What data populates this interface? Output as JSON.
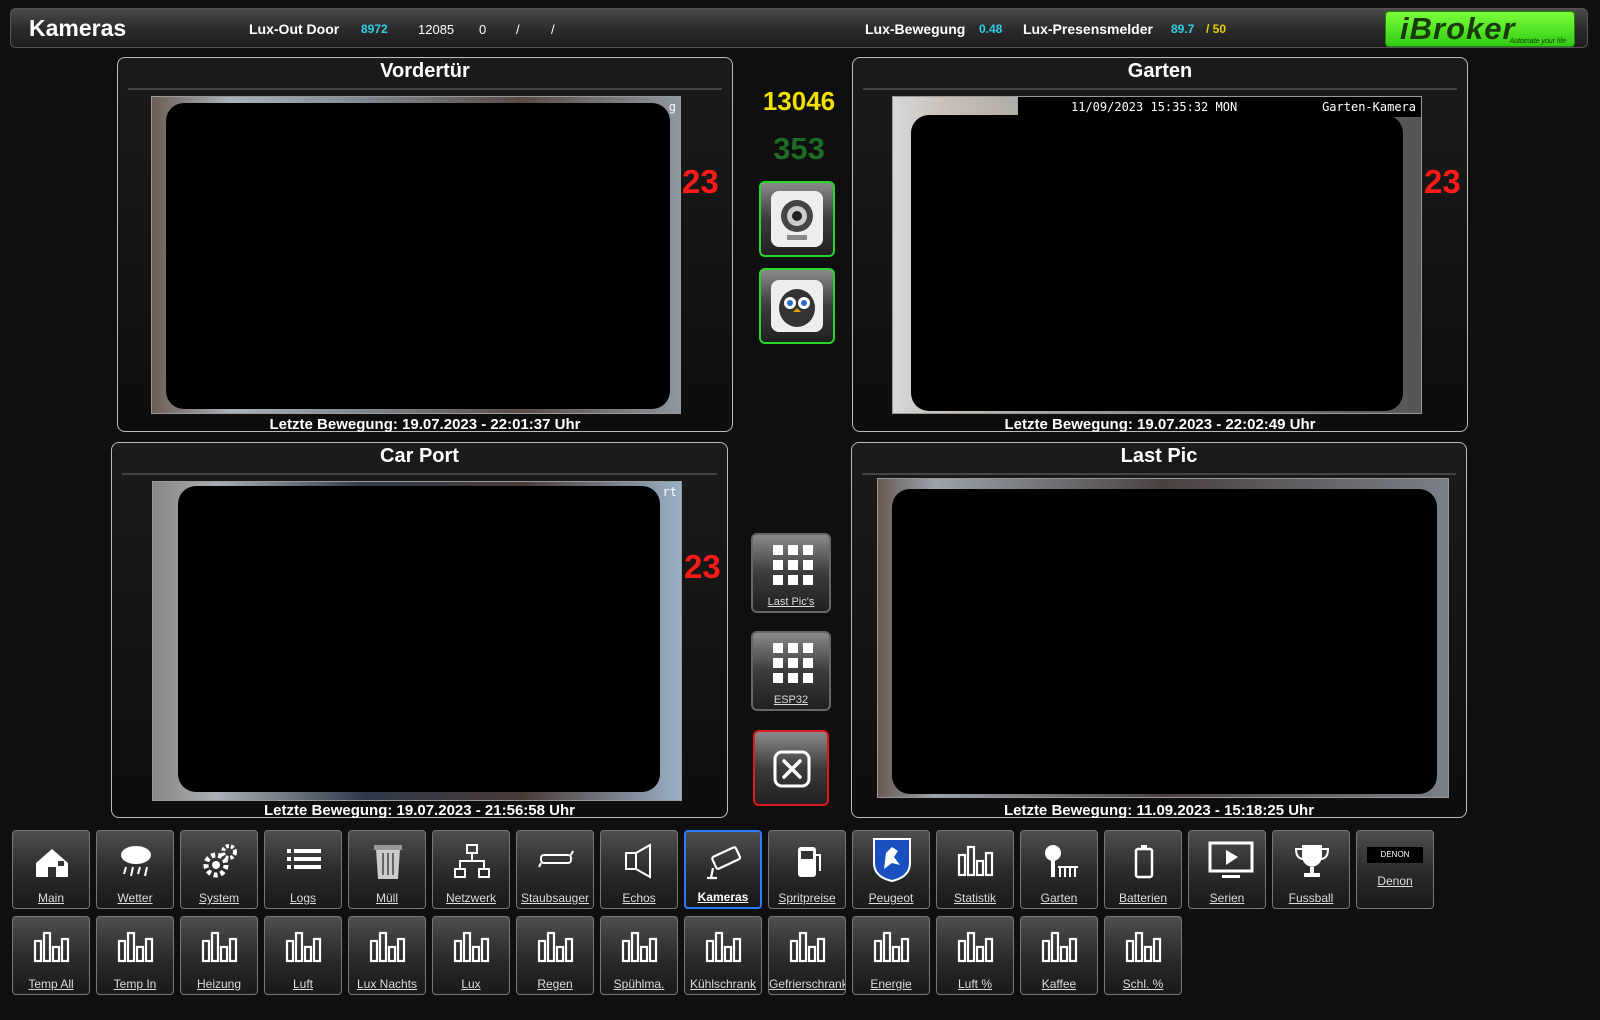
{
  "header": {
    "title": "Kameras",
    "lux_out_door_label": "Lux-Out Door",
    "lux_out_door_value": "8972",
    "value_b": "12085",
    "value_c": "0",
    "sep1": "/",
    "sep2": "/",
    "lux_bewegung_label": "Lux-Bewegung",
    "lux_bewegung_value": "0.48",
    "lux_presens_label": "Lux-Presensmelder",
    "lux_presens_value": "89.7",
    "lux_presens_max": "/ 50",
    "logo_text": "iBroker",
    "logo_tagline": "Automate your life"
  },
  "colors": {
    "accent_green": "#27d52b",
    "alert_red": "#ff1a1a",
    "active_blue": "#2a7bff",
    "value_cyan": "#30d0e8",
    "value_yellow": "#e8d000"
  },
  "cameras": {
    "vordertuer": {
      "title": "Vordertür",
      "count": "23",
      "last_motion": "Letzte Bewegung: 19.07.2023 - 22:01:37 Uhr",
      "osd_right": "g"
    },
    "garten": {
      "title": "Garten",
      "count": "23",
      "osd_datetime": "11/09/2023 15:35:32 MON",
      "osd_name": "Garten-Kamera",
      "last_motion": "Letzte Bewegung: 19.07.2023 - 22:02:49 Uhr"
    },
    "carport": {
      "title": "Car Port",
      "count": "23",
      "osd_right": "rt",
      "last_motion": "Letzte Bewegung: 19.07.2023 - 21:56:58 Uhr"
    },
    "lastpic": {
      "title": "Last Pic",
      "last_motion": "Letzte Bewegung: 11.09.2023 - 15:18:25 Uhr"
    }
  },
  "center": {
    "counter_main": "13046",
    "counter_sub": "353",
    "tile_last_pics": "Last Pic's",
    "tile_esp32": "ESP32"
  },
  "nav_row1": [
    {
      "label": "Main",
      "icon": "house-icon"
    },
    {
      "label": "Wetter",
      "icon": "weather-icon"
    },
    {
      "label": "System",
      "icon": "gears-icon"
    },
    {
      "label": "Logs",
      "icon": "list-icon"
    },
    {
      "label": "Müll",
      "icon": "trash-icon"
    },
    {
      "label": "Netzwerk",
      "icon": "network-icon"
    },
    {
      "label": "Staubsauger",
      "icon": "vacuum-icon"
    },
    {
      "label": "Echos",
      "icon": "speaker-icon"
    },
    {
      "label": "Kameras",
      "icon": "camera-icon",
      "active": true
    },
    {
      "label": "Spritpreise",
      "icon": "fuel-icon"
    },
    {
      "label": "Peugeot",
      "icon": "peugeot-icon"
    },
    {
      "label": "Statistik",
      "icon": "bars-icon"
    },
    {
      "label": "Garten",
      "icon": "garden-icon"
    },
    {
      "label": "Batterien",
      "icon": "battery-icon"
    },
    {
      "label": "Serien",
      "icon": "play-icon"
    },
    {
      "label": "Fussball",
      "icon": "trophy-icon"
    },
    {
      "label": "Denon",
      "icon": "denon-icon",
      "badge": "DENON"
    }
  ],
  "nav_row2": [
    {
      "label": "Temp All"
    },
    {
      "label": "Temp In"
    },
    {
      "label": "Heizung"
    },
    {
      "label": "Luft"
    },
    {
      "label": "Lux Nachts"
    },
    {
      "label": "Lux"
    },
    {
      "label": "Regen"
    },
    {
      "label": "Spühlma."
    },
    {
      "label": "Kühlschrank"
    },
    {
      "label": "Gefrierschrank"
    },
    {
      "label": "Energie"
    },
    {
      "label": "Luft %"
    },
    {
      "label": "Kaffee"
    },
    {
      "label": "Schl. %"
    }
  ]
}
